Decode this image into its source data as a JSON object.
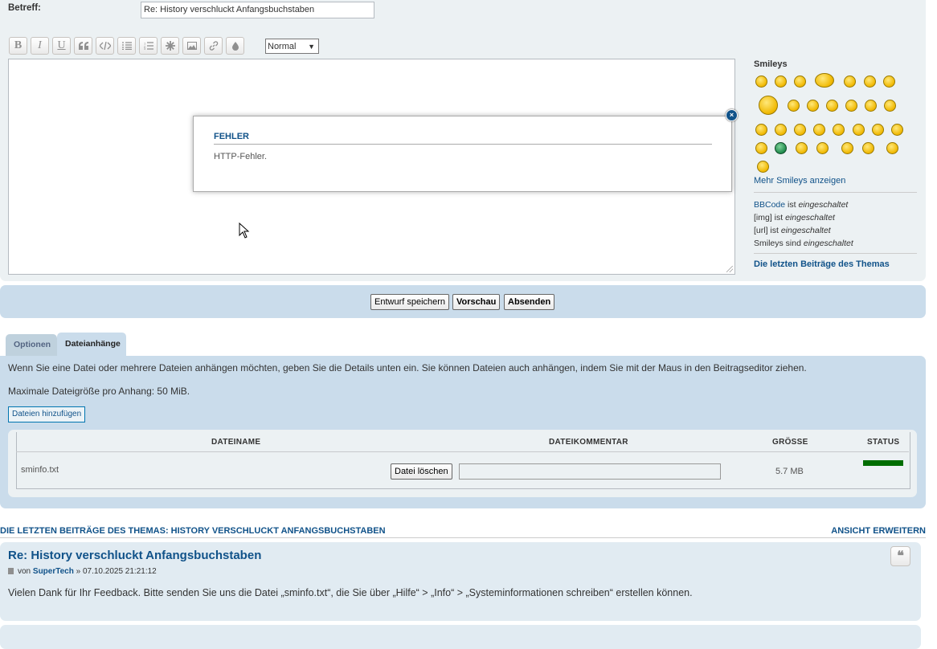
{
  "form": {
    "subject_label": "Betreff:",
    "subject_value": "Re: History verschluckt Anfangsbuchstaben",
    "font_size_select": "Normal"
  },
  "toolbar": {
    "buttons": [
      "bold-icon",
      "italic-icon",
      "underline-icon",
      "quote-icon",
      "code-icon",
      "list-icon",
      "numbered-list-icon",
      "list-item-icon",
      "image-icon",
      "link-icon",
      "color-icon"
    ],
    "bold": "B",
    "italic": "I",
    "underline": "U"
  },
  "smileys": {
    "title": "Smileys",
    "more": "Mehr Smileys anzeigen"
  },
  "settings": {
    "bbcode_link": "BBCode",
    "bbcode_text": " ist ",
    "img_text": "[img] ist ",
    "url_text": "[url] ist ",
    "smileys_text": "Smileys sind ",
    "enabled": "eingeschaltet",
    "last_posts_link": "Die letzten Beiträge des Themas"
  },
  "actions": {
    "save_draft": "Entwurf speichern",
    "preview": "Vorschau",
    "submit": "Absenden"
  },
  "tabs": {
    "options": "Optionen",
    "attachments": "Dateianhänge"
  },
  "attachments": {
    "info": "Wenn Sie eine Datei oder mehrere Dateien anhängen möchten, geben Sie die Details unten ein. Sie können Dateien auch anhängen, indem Sie mit der Maus in den Beitragseditor ziehen.",
    "max_size": "Maximale Dateigröße pro Anhang: 50 MiB.",
    "add_files": "Dateien hinzufügen",
    "columns": [
      "DATEINAME",
      "DATEIKOMMENTAR",
      "GRÖSSE",
      "STATUS"
    ],
    "files": [
      {
        "name": "sminfo.txt",
        "delete_label": "Datei löschen",
        "comment": "",
        "size": "5.7 MB",
        "status_color": "#006d00",
        "progress": 1.0
      }
    ]
  },
  "last_posts": {
    "title": "Die letzten Beiträge des Themas: History verschluckt Anfangsbuchstaben",
    "expand": "Ansicht erweitern",
    "post": {
      "title": "Re: History verschluckt Anfangsbuchstaben",
      "by": "von",
      "author": "SuperTech",
      "date": "» 07.10.2025 21:21:12",
      "body": "Vielen Dank für Ihr Feedback. Bitte senden Sie uns die Datei „sminfo.txt“, die Sie über „Hilfe“ > „Info“ > „Systeminformationen schreiben“ erstellen können."
    }
  },
  "modal": {
    "title": "FEHLER",
    "message": "HTTP-Fehler."
  },
  "colors": {
    "link": "#105289",
    "panel_blue": "#cadceb",
    "panel_grey": "#ecf1f3",
    "status_green": "#006d00"
  }
}
